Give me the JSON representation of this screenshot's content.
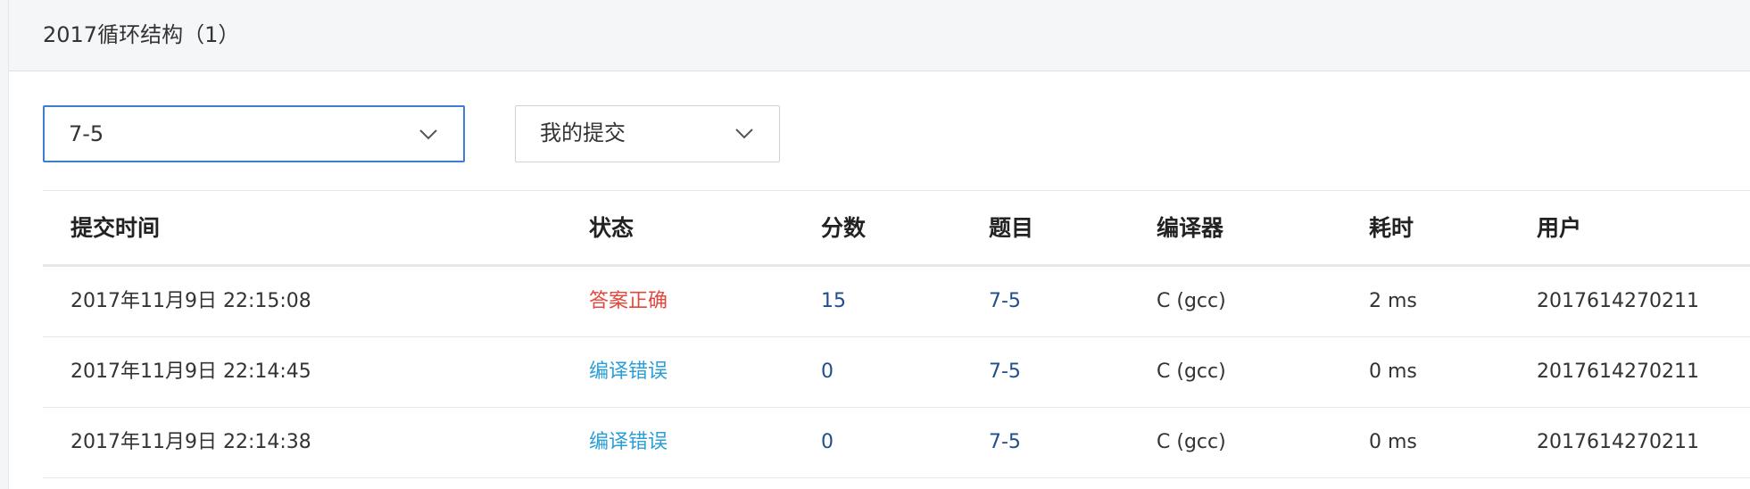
{
  "header": {
    "title": "2017循环结构（1）"
  },
  "filters": {
    "problem_select": {
      "value": "7-5",
      "icon": "chevron-down-icon"
    },
    "scope_select": {
      "value": "我的提交",
      "icon": "chevron-down-icon"
    }
  },
  "table": {
    "columns": [
      "提交时间",
      "状态",
      "分数",
      "题目",
      "编译器",
      "耗时",
      "用户"
    ],
    "rows": [
      {
        "time": "2017年11月9日 22:15:08",
        "status": "答案正确",
        "score": "15",
        "problem": "7-5",
        "compiler": "C (gcc)",
        "duration": "2 ms",
        "user": "2017614270211"
      },
      {
        "time": "2017年11月9日 22:14:45",
        "status": "编译错误",
        "score": "0",
        "problem": "7-5",
        "compiler": "C (gcc)",
        "duration": "0 ms",
        "user": "2017614270211"
      },
      {
        "time": "2017年11月9日 22:14:38",
        "status": "编译错误",
        "score": "0",
        "problem": "7-5",
        "compiler": "C (gcc)",
        "duration": "0 ms",
        "user": "2017614270211"
      }
    ]
  },
  "colors": {
    "accepted": "#e2483d",
    "compile_error": "#2a9fd6",
    "link": "#1f4e8c",
    "focus_border": "#3b7fd0"
  }
}
